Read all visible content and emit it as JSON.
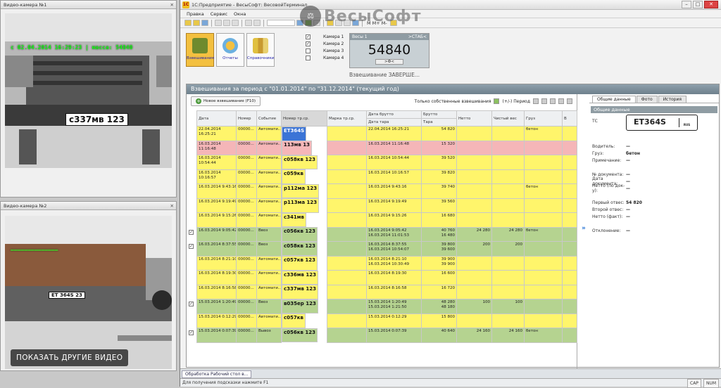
{
  "cam1": {
    "title": "Видео-камера №1",
    "overlay": "с 02.04.2014 16:29:23 | масса: 54840",
    "plate": "с337мв 123"
  },
  "cam2": {
    "title": "Видео-камера №2",
    "plate": "ЕТ 364S 23",
    "more_button": "ПОКАЗАТЬ ДРУГИЕ ВИДЕО"
  },
  "window": {
    "title": "1С:Предприятие - ВесыСофт: ВесовойТерминал",
    "watermark": "ВесыСофт"
  },
  "menu": [
    "Правка",
    "Сервис",
    "Окна"
  ],
  "toolbar_text": "M M+ M-",
  "big_buttons": [
    "Взвешивания",
    "Отчеты",
    "Справочники"
  ],
  "cameras": [
    {
      "label": "Камера 1",
      "checked": true
    },
    {
      "label": "Камера 2",
      "checked": true
    },
    {
      "label": "Камера 3",
      "checked": false
    },
    {
      "label": "Камера 4",
      "checked": false
    }
  ],
  "scale": {
    "name": "Весы 1",
    "state": ">СТАБ<",
    "value": "54840",
    "footer": ">Ф<"
  },
  "status_text": "Взвешивание ЗАВЕРШЕ...",
  "content_title": "Взвешивания за период с \"01.01.2014\" по \"31.12.2014\" (текущий год)",
  "list_toolbar": {
    "new_button": "Новое взвешивание (F10)",
    "only_own": "Только собственные взвешивания",
    "period": "(+/-) Период"
  },
  "columns": [
    "Дата",
    "Номер",
    "Событие",
    "Номер тр.ср.",
    "Марка тр.ср.",
    "Дата брутто",
    "Брутто",
    "Нетто",
    "Чистый вес",
    "Груз",
    "В"
  ],
  "subcolumns": {
    "tare_date": "Дата тара",
    "tare": "Тара"
  },
  "rows": [
    {
      "color": "yellow",
      "checked": false,
      "date": "22.04.2014\n16:25:21",
      "num": "00000...",
      "event": "Автомати...",
      "plate": "ET364S",
      "brand": "",
      "dgross": "22.04.2014 16:25:21",
      "gross": "54 820",
      "net": "",
      "clean": "",
      "cargo": "бетон",
      "selected": true
    },
    {
      "color": "pink",
      "checked": false,
      "date": "16.03.2014\n11:16:48",
      "num": "00000...",
      "event": "Автомати...",
      "plate": "113мв 13",
      "brand": "",
      "dgross": "16.03.2014 11:16:48",
      "gross": "15 320",
      "net": "",
      "clean": "",
      "cargo": ""
    },
    {
      "color": "yellow",
      "checked": false,
      "date": "16.03.2014\n10:54:44",
      "num": "00000...",
      "event": "Автомати...",
      "plate": "с058кв 123",
      "brand": "",
      "dgross": "16.03.2014 10:54:44",
      "gross": "39 520",
      "net": "",
      "clean": "",
      "cargo": ""
    },
    {
      "color": "yellow",
      "checked": false,
      "date": "16.03.2014\n10:16:57",
      "num": "00000...",
      "event": "Автомати...",
      "plate": "с059кв",
      "brand": "",
      "dgross": "16.03.2014 10:16:57",
      "gross": "39 820",
      "net": "",
      "clean": "",
      "cargo": ""
    },
    {
      "color": "yellow",
      "checked": false,
      "date": "16.03.2014 9:43:16",
      "num": "00000...",
      "event": "Автомати...",
      "plate": "р112ма 123",
      "brand": "",
      "dgross": "16.03.2014 9:43:16",
      "gross": "39 740",
      "net": "",
      "clean": "",
      "cargo": "бетон"
    },
    {
      "color": "yellow",
      "checked": false,
      "date": "16.03.2014 9:19:49",
      "num": "00000...",
      "event": "Автомати...",
      "plate": "р113ма 123",
      "brand": "",
      "dgross": "16.03.2014 9:19:49",
      "gross": "39 560",
      "net": "",
      "clean": "",
      "cargo": ""
    },
    {
      "color": "yellow",
      "checked": false,
      "date": "16.03.2014 9:15:26",
      "num": "00000...",
      "event": "Автомати...",
      "plate": "с341мв",
      "brand": "",
      "dgross": "16.03.2014 9:15:26",
      "gross": "16 680",
      "net": "",
      "clean": "",
      "cargo": ""
    },
    {
      "color": "green",
      "checked": true,
      "date": "16.03.2014 9:05:42",
      "num": "00000...",
      "event": "Ввоз",
      "plate": "с056кв 123",
      "brand": "",
      "dgross": "16.03.2014 9:05:42\n16.03.2014 11:01:53",
      "gross": "40 760\n16 480",
      "net": "24 280",
      "clean": "24 280",
      "cargo": "бетон"
    },
    {
      "color": "green",
      "checked": true,
      "date": "16.03.2014 8:37:55",
      "num": "00000...",
      "event": "Ввоз",
      "plate": "с058кв 123",
      "brand": "",
      "dgross": "16.03.2014 8:37:55\n16.03.2014 10:54:07",
      "gross": "39 800\n39 600",
      "net": "200",
      "clean": "200",
      "cargo": ""
    },
    {
      "color": "yellow",
      "checked": false,
      "date": "16.03.2014 8:21:10",
      "num": "00000...",
      "event": "Автомати...",
      "plate": "с057кв 123",
      "brand": "",
      "dgross": "16.03.2014 8:21:10\n16.03.2014 10:30:49",
      "gross": "39 900\n39 900",
      "net": "",
      "clean": "",
      "cargo": ""
    },
    {
      "color": "yellow",
      "checked": false,
      "date": "16.03.2014 8:19:30",
      "num": "00000...",
      "event": "Автомати...",
      "plate": "с336мв 123",
      "brand": "",
      "dgross": "16.03.2014 8:19:30",
      "gross": "16 600",
      "net": "",
      "clean": "",
      "cargo": ""
    },
    {
      "color": "yellow",
      "checked": false,
      "date": "16.03.2014 8:16:58",
      "num": "00000...",
      "event": "Автомати...",
      "plate": "с337мв 123",
      "brand": "",
      "dgross": "16.03.2014 8:16:58",
      "gross": "16 720",
      "net": "",
      "clean": "",
      "cargo": ""
    },
    {
      "color": "green",
      "checked": true,
      "date": "15.03.2014 1:20:49",
      "num": "00000...",
      "event": "Ввоз",
      "plate": "в035ер 123",
      "brand": "",
      "dgross": "15.03.2014 1:20:49\n15.03.2014 1:21:50",
      "gross": "48 280\n48 180",
      "net": "100",
      "clean": "100",
      "cargo": ""
    },
    {
      "color": "yellow",
      "checked": false,
      "date": "15.03.2014 0:12:29",
      "num": "00000...",
      "event": "Автомати...",
      "plate": "с057кв",
      "brand": "",
      "dgross": "15.03.2014 0:12:29",
      "gross": "15 800",
      "net": "",
      "clean": "",
      "cargo": ""
    },
    {
      "color": "green",
      "checked": true,
      "date": "15.03.2014 0:07:39",
      "num": "00000...",
      "event": "Вывоз",
      "plate": "с056кв 123",
      "brand": "",
      "dgross": "15.03.2014 0:07:39",
      "gross": "40 640",
      "net": "24 160",
      "clean": "24 160",
      "cargo": "бетон"
    }
  ],
  "right_tabs": [
    "Общие данные",
    "Фото",
    "История"
  ],
  "details": {
    "header": "Общие данные",
    "ts_label": "ТС",
    "plate": "ET364S",
    "flag": "RUS",
    "fields": [
      {
        "k": "Водитель:",
        "v": "—"
      },
      {
        "k": "Груз:",
        "v": "бетон"
      },
      {
        "k": "Примечание:",
        "v": "—"
      },
      {
        "k": "№ документа:",
        "v": "—"
      },
      {
        "k": "Дата документа:",
        "v": "—"
      },
      {
        "k": "Нетто (по док-у):",
        "v": "—"
      },
      {
        "k": "Первый отвес:",
        "v": "54 820"
      },
      {
        "k": "Второй отвес:",
        "v": "—"
      },
      {
        "k": "Нетто (факт):",
        "v": "—"
      },
      {
        "k": "Отклонение:",
        "v": "—"
      }
    ]
  },
  "taskbar_item": "Обработка  Рабочий стол в...",
  "statusbar": {
    "hint": "Для получения подсказки нажмите F1",
    "caps": "CAP",
    "num": "NUM"
  }
}
